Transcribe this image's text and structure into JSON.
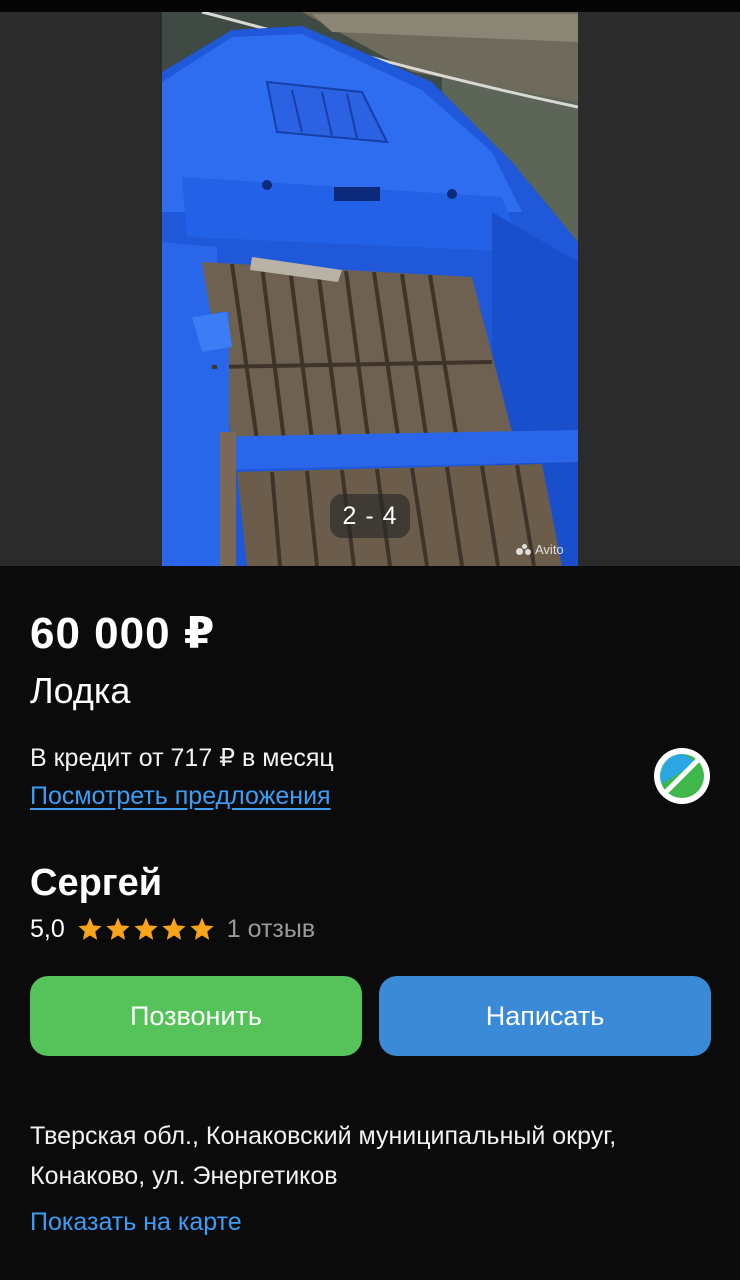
{
  "gallery": {
    "counter": "2 - 4",
    "watermark": "Avito",
    "photo_subject": "blue-wooden-boat"
  },
  "listing": {
    "price": "60 000 ₽",
    "title": "Лодка",
    "credit_text": "В кредит от 717 ₽ в месяц",
    "offers_link": "Посмотреть предложения"
  },
  "seller": {
    "name": "Сергей",
    "rating_value": "5,0",
    "stars": 5,
    "reviews": "1 отзыв"
  },
  "actions": {
    "call_label": "Позвонить",
    "write_label": "Написать"
  },
  "location": {
    "address_line1": "Тверская обл., Конаковский муниципальный округ,",
    "address_line2": "Конаково, ул. Энергетиков",
    "map_link": "Показать на карте"
  },
  "colors": {
    "background": "#0b0b0c",
    "call_button": "#56c25a",
    "write_button": "#3a8ad8",
    "link": "#3d9df5",
    "star": "#f7a31c"
  },
  "icons": {
    "bank_logo": "bank-logo-icon",
    "star": "star-icon"
  }
}
